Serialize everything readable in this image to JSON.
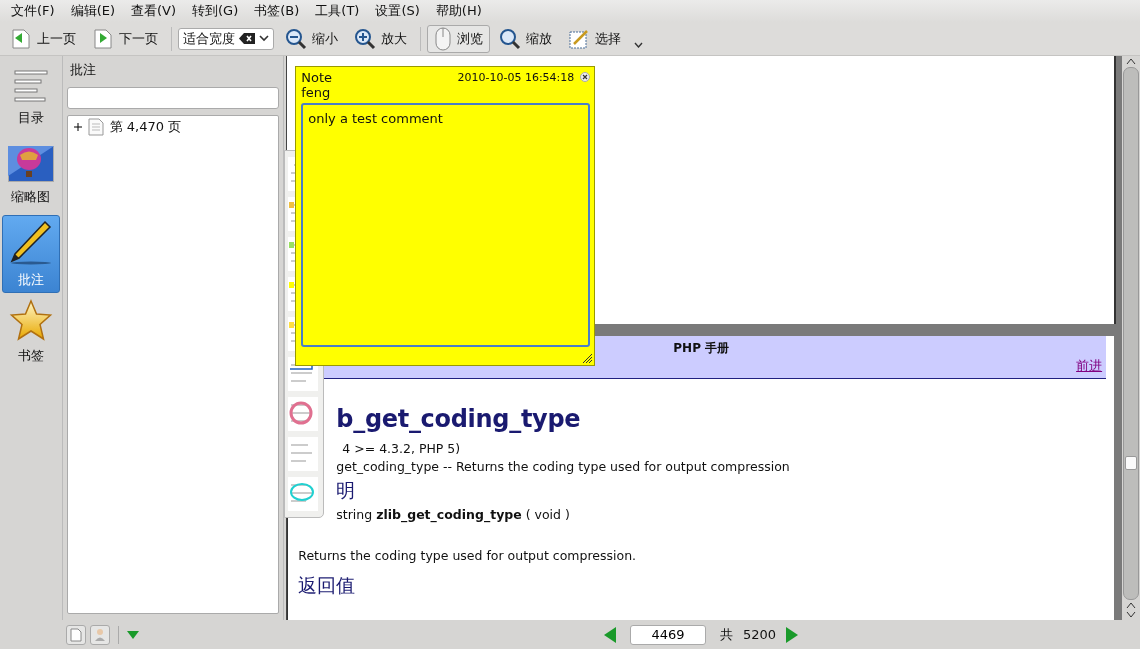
{
  "menu": [
    "文件(F)",
    "编辑(E)",
    "查看(V)",
    "转到(G)",
    "书签(B)",
    "工具(T)",
    "设置(S)",
    "帮助(H)"
  ],
  "toolbar": [
    {
      "kind": "button",
      "label": "上一页"
    },
    {
      "kind": "button",
      "label": "下一页"
    },
    {
      "kind": "combo",
      "label": "适合宽度"
    },
    {
      "kind": "button",
      "label": "缩小"
    },
    {
      "kind": "button",
      "label": "放大"
    },
    {
      "kind": "tool",
      "label": "浏览",
      "selected": true
    },
    {
      "kind": "tool",
      "label": "缩放",
      "selected": false
    },
    {
      "kind": "tool",
      "label": "选择",
      "selected": false
    }
  ],
  "sidebar": [
    {
      "label": "目录",
      "selected": false
    },
    {
      "label": "缩略图",
      "selected": false
    },
    {
      "label": "批注",
      "selected": true
    },
    {
      "label": "书签",
      "selected": false
    }
  ],
  "panel": {
    "title": "批注",
    "tree": [
      {
        "label": "第 4,470 页",
        "expanded": false
      }
    ]
  },
  "note": {
    "title": "Note",
    "timestamp": "2010-10-05 16:54:18",
    "author": "feng",
    "text": "only a test comment"
  },
  "document": {
    "header": "PHP 手册",
    "link": "前进",
    "title": "b_get_coding_type",
    "version": "4 >= 4.3.2, PHP 5)",
    "summary": "get_coding_type -- Returns the coding type used for output compression",
    "section1": "明",
    "signature": "string **zlib_get_coding_type** ( void )",
    "description": "Returns the coding type used for output compression.",
    "section2": "返回值"
  },
  "status": {
    "page": "4469",
    "of": "共",
    "total": "5200"
  }
}
